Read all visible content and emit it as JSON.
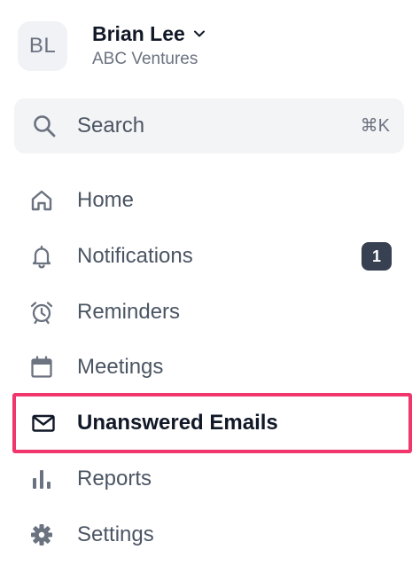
{
  "account": {
    "initials": "BL",
    "name": "Brian Lee",
    "org": "ABC Ventures"
  },
  "search": {
    "label": "Search",
    "shortcut": "⌘K"
  },
  "nav": {
    "items": [
      {
        "label": "Home",
        "icon": "home-icon"
      },
      {
        "label": "Notifications",
        "icon": "bell-icon",
        "badge": "1"
      },
      {
        "label": "Reminders",
        "icon": "alarm-clock-icon"
      },
      {
        "label": "Meetings",
        "icon": "calendar-icon"
      },
      {
        "label": "Unanswered Emails",
        "icon": "envelope-icon",
        "active": true
      },
      {
        "label": "Reports",
        "icon": "bar-chart-icon"
      },
      {
        "label": "Settings",
        "icon": "gear-icon"
      }
    ]
  },
  "colors": {
    "highlight": "#f0366b",
    "badge_bg": "#374151",
    "muted_text": "#4b5563",
    "search_bg": "#f3f4f6"
  }
}
